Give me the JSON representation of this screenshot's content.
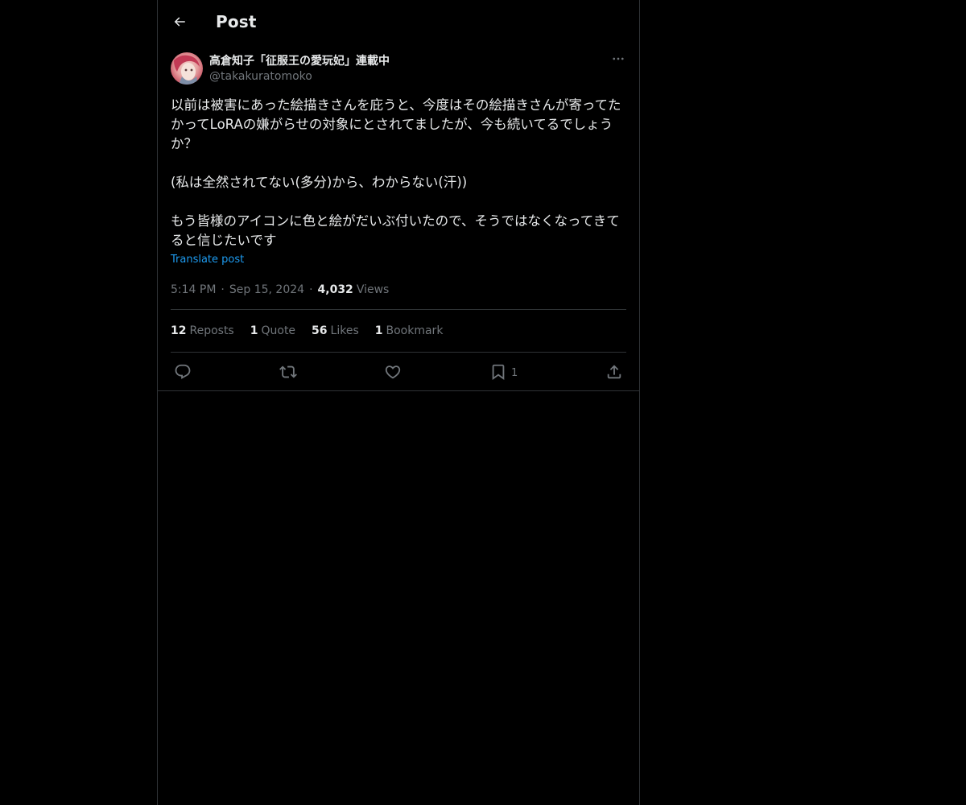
{
  "header": {
    "title": "Post"
  },
  "post": {
    "author": {
      "display_name": "高倉知子「征服王の愛玩妃」連載中",
      "handle": "@takakuratomoko"
    },
    "text": "以前は被害にあった絵描きさんを庇うと、今度はその絵描きさんが寄ってたかってLoRAの嫌がらせの対象にとされてましたが、今も続いてるでしょうか？\n\n(私は全然されてない(多分)から、わからない(汗))\n\nもう皆様のアイコンに色と絵がだいぶ付いたので、そうではなくなってきてると信じたいです",
    "translate_label": "Translate post",
    "time": "5:14 PM",
    "date": "Sep 15, 2024",
    "views_count": "4,032",
    "views_label": "Views",
    "separator": "·"
  },
  "stats": {
    "reposts_count": "12",
    "reposts_label": "Reposts",
    "quotes_count": "1",
    "quotes_label": "Quote",
    "likes_count": "56",
    "likes_label": "Likes",
    "bookmarks_count": "1",
    "bookmarks_label": "Bookmark"
  },
  "actions": {
    "bookmark_count": "1"
  },
  "colors": {
    "background": "#000000",
    "text_primary": "#e7e9ea",
    "text_secondary": "#71767b",
    "accent_link": "#1d9bf0",
    "border": "#2f3336"
  },
  "icons": {
    "back": "arrow-left-icon",
    "more": "more-dots-icon",
    "reply": "reply-bubble-icon",
    "repost": "repost-icon",
    "like": "heart-icon",
    "bookmark": "bookmark-icon",
    "share": "share-icon"
  }
}
